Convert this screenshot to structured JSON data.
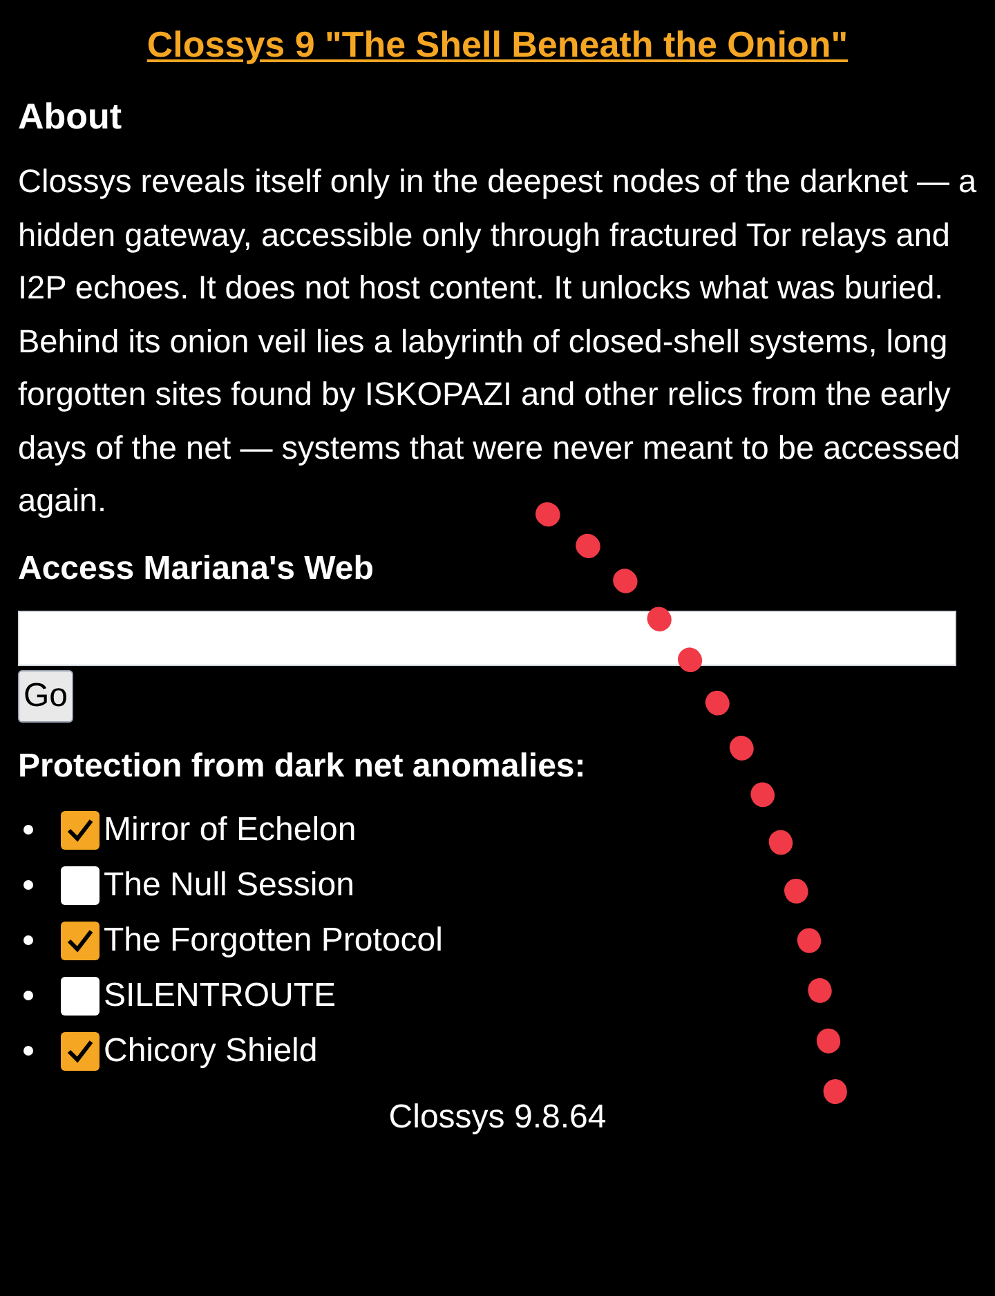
{
  "title": "Clossys 9 \"The Shell Beneath the Onion\"",
  "about": {
    "heading": "About",
    "text": "Clossys reveals itself only in the deepest nodes of the darknet — a hidden gateway, accessible only through fractured Tor relays and I2P echoes. It does not host content. It unlocks what was buried. Behind its onion veil lies a labyrinth of closed-shell systems, long forgotten sites found by ISKOPAZI and other relics from the early days of the net — systems that were never meant to be accessed again."
  },
  "access": {
    "heading": "Access Mariana's Web",
    "button": "Go"
  },
  "protection": {
    "heading": "Protection from dark net anomalies:",
    "items": [
      {
        "label": "Mirror of Echelon",
        "checked": true
      },
      {
        "label": "The Null Session",
        "checked": false
      },
      {
        "label": "The Forgotten Protocol",
        "checked": true
      },
      {
        "label": "SILENTROUTE",
        "checked": false
      },
      {
        "label": "Chicory Shield",
        "checked": true
      }
    ]
  },
  "footer": "Clossys 9.8.64"
}
